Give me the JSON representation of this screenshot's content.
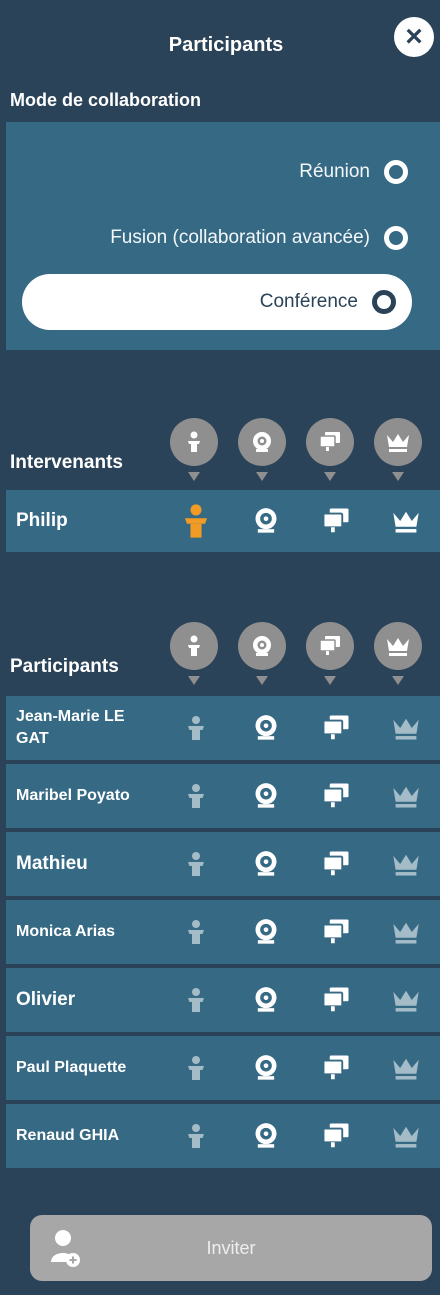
{
  "header": {
    "title": "Participants",
    "close_icon": "close-icon"
  },
  "mode": {
    "title": "Mode de collaboration",
    "options": [
      {
        "label": "Réunion"
      },
      {
        "label": "Fusion (collaboration avancée)"
      },
      {
        "label": "Conférence"
      }
    ]
  },
  "speakers": {
    "title": "Intervenants",
    "rows": [
      {
        "name": "Philip"
      }
    ]
  },
  "participants": {
    "title": "Participants",
    "rows": [
      {
        "name": "Jean-Marie LE GAT"
      },
      {
        "name": "Maribel Poyato"
      },
      {
        "name": "Mathieu"
      },
      {
        "name": "Monica Arias"
      },
      {
        "name": "Olivier"
      },
      {
        "name": "Paul Plaquette"
      },
      {
        "name": "Renaud GHIA"
      }
    ]
  },
  "invite": {
    "label": "Inviter",
    "icon": "add-user-icon"
  },
  "colors": {
    "panel": "#2b4358",
    "row": "#366a84",
    "speaker_active": "#f29b24",
    "invite": "#a7a7a7"
  }
}
